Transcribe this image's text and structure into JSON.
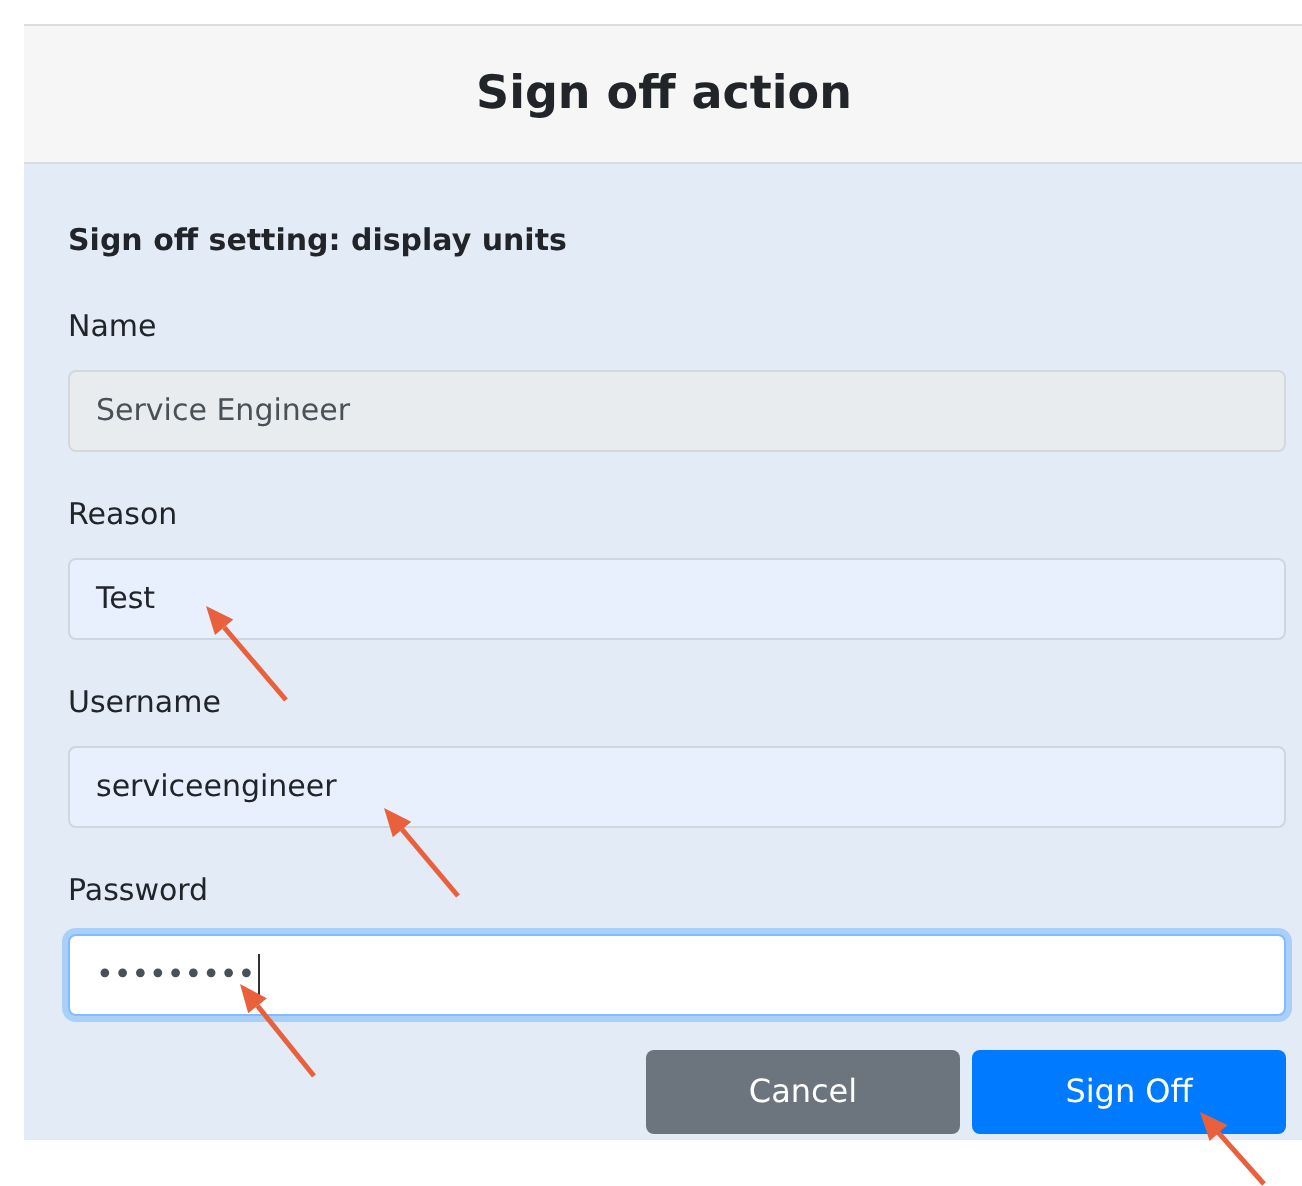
{
  "dialog": {
    "title": "Sign off action"
  },
  "section_title": "Sign off setting: display units",
  "fields": [
    {
      "label": "Name",
      "value": "Service Engineer",
      "disabled": true,
      "focused": false
    },
    {
      "label": "Reason",
      "value": "Test",
      "disabled": false,
      "focused": false
    },
    {
      "label": "Username",
      "value": "serviceengineer",
      "disabled": false,
      "focused": false
    },
    {
      "label": "Password",
      "value": "•••••••••",
      "disabled": false,
      "focused": true
    }
  ],
  "buttons": [
    {
      "label": "Cancel",
      "kind": "secondary"
    },
    {
      "label": "Sign Off",
      "kind": "primary"
    }
  ]
}
